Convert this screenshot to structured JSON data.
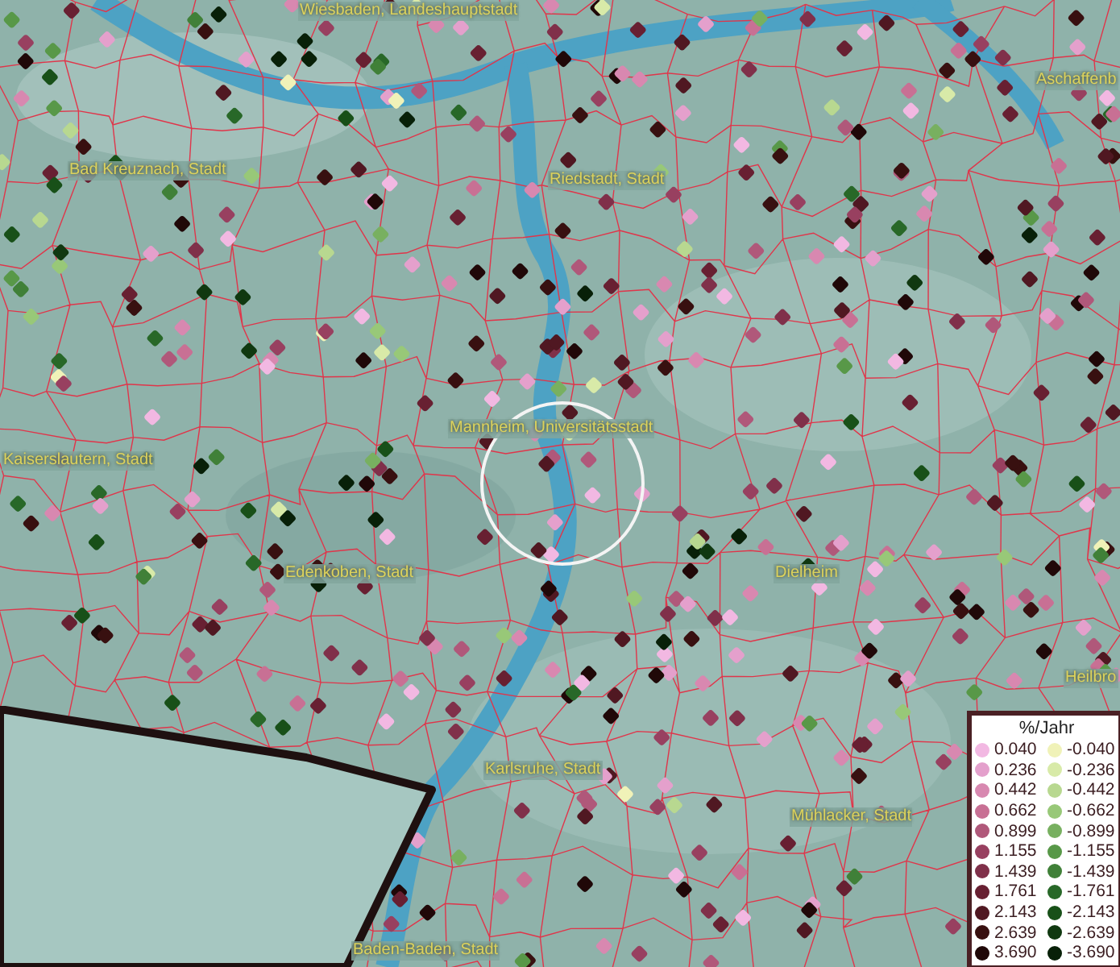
{
  "map": {
    "city_labels": [
      {
        "name": "Wiesbaden, Landeshauptstadt"
      },
      {
        "name": "Aschaffenb"
      },
      {
        "name": "Bad Kreuznach, Stadt"
      },
      {
        "name": "Riedstadt, Stadt"
      },
      {
        "name": "Mannheim, Universitätsstadt"
      },
      {
        "name": "Kaiserslautern, Stadt"
      },
      {
        "name": "Edenkoben, Stadt"
      },
      {
        "name": "Dielheim"
      },
      {
        "name": "Heilbro"
      },
      {
        "name": "Karlsruhe, Stadt"
      },
      {
        "name": "Mühlacker, Stadt"
      },
      {
        "name": "Baden-Baden, Stadt"
      }
    ]
  },
  "legend": {
    "title": "%/Jahr",
    "rows": [
      {
        "positive": {
          "label": "0.040",
          "color": "#f2b8e2"
        },
        "negative": {
          "label": "-0.040",
          "color": "#f0f2b8"
        }
      },
      {
        "positive": {
          "label": "0.236",
          "color": "#e4a0cc"
        },
        "negative": {
          "label": "-0.236",
          "color": "#d8eaa8"
        }
      },
      {
        "positive": {
          "label": "0.442",
          "color": "#d888b0"
        },
        "negative": {
          "label": "-0.442",
          "color": "#b8d890"
        }
      },
      {
        "positive": {
          "label": "0.662",
          "color": "#c87094"
        },
        "negative": {
          "label": "-0.662",
          "color": "#98c878"
        }
      },
      {
        "positive": {
          "label": "0.899",
          "color": "#b0587a"
        },
        "negative": {
          "label": "-0.899",
          "color": "#78b060"
        }
      },
      {
        "positive": {
          "label": "1.155",
          "color": "#984060"
        },
        "negative": {
          "label": "-1.155",
          "color": "#589848"
        }
      },
      {
        "positive": {
          "label": "1.439",
          "color": "#80304a"
        },
        "negative": {
          "label": "-1.439",
          "color": "#408038"
        }
      },
      {
        "positive": {
          "label": "1.761",
          "color": "#682032"
        },
        "negative": {
          "label": "-1.761",
          "color": "#286828"
        }
      },
      {
        "positive": {
          "label": "2.143",
          "color": "#501822"
        },
        "negative": {
          "label": "-2.143",
          "color": "#185018"
        }
      },
      {
        "positive": {
          "label": "2.639",
          "color": "#381010"
        },
        "negative": {
          "label": "-2.639",
          "color": "#103810"
        }
      },
      {
        "positive": {
          "label": "3.690",
          "color": "#200808"
        },
        "negative": {
          "label": "-3.690",
          "color": "#082008"
        }
      }
    ]
  }
}
